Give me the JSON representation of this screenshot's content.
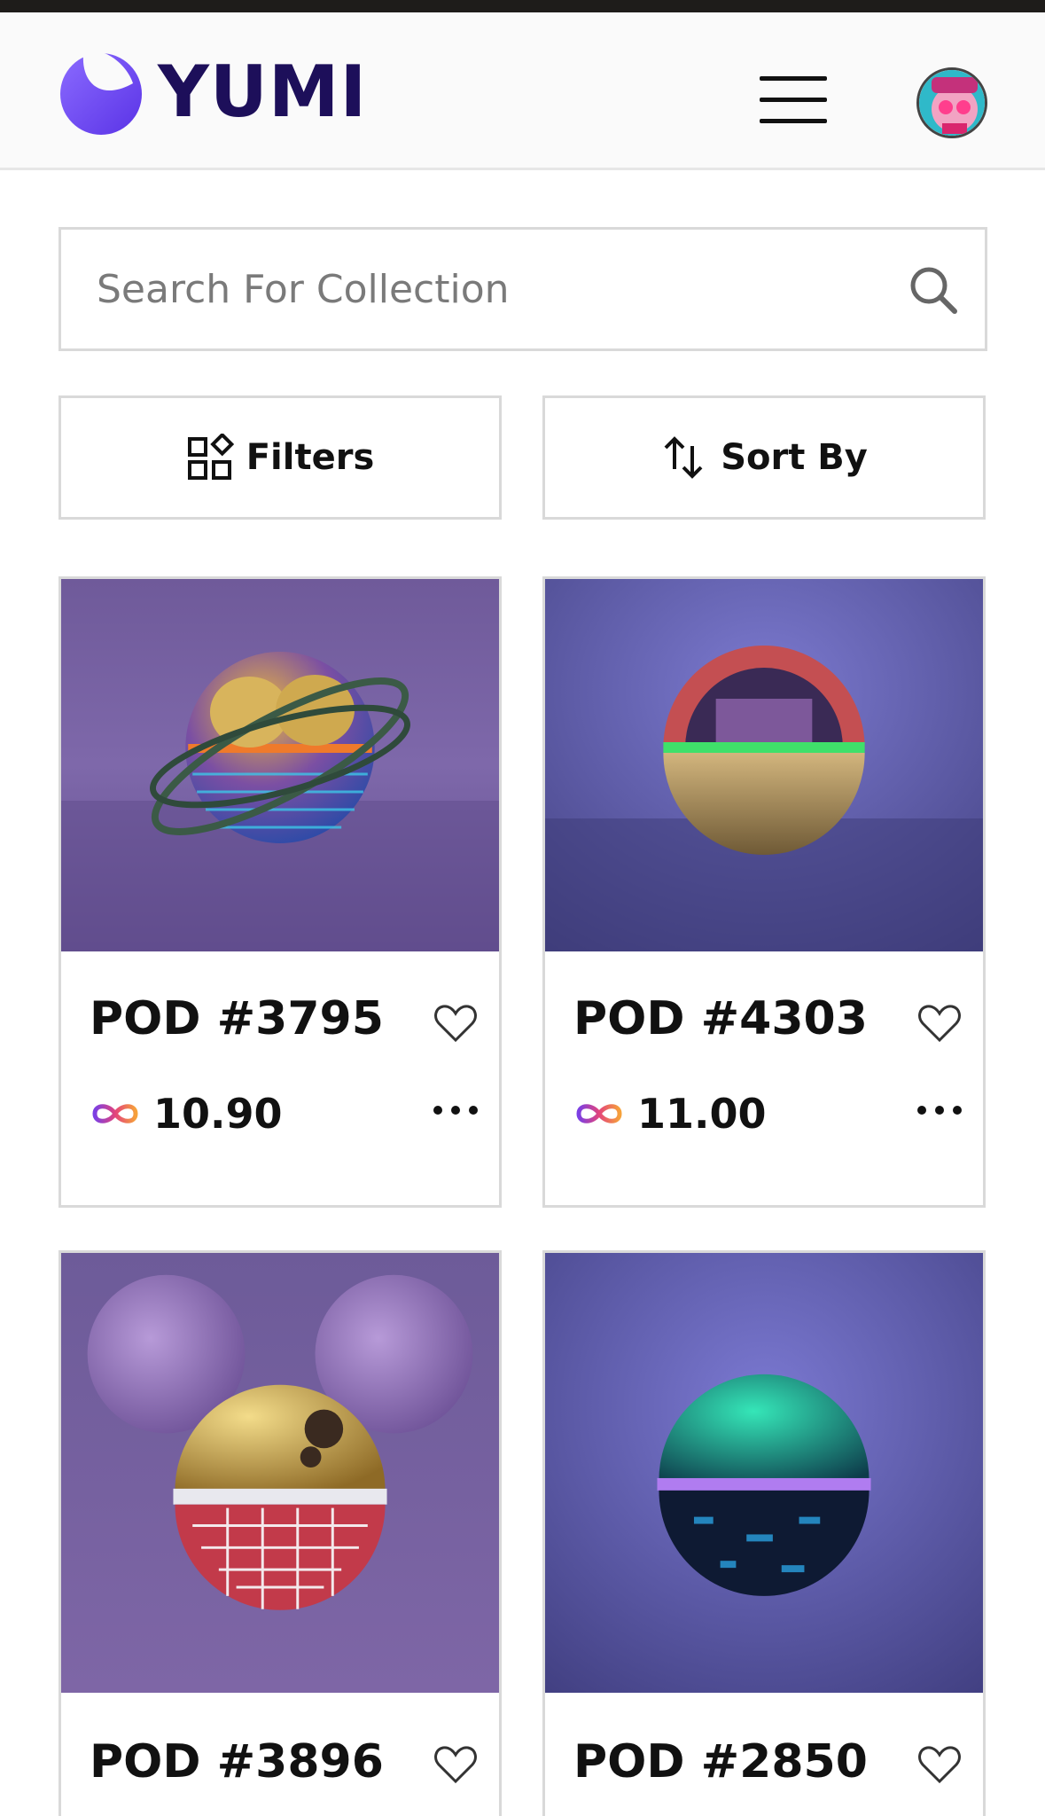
{
  "header": {
    "logo_text": "YUMI",
    "brand_color": "#6c4cf3",
    "logo_text_color": "#1d0f5a",
    "menu_icon": "hamburger-menu-icon",
    "avatar_icon": "user-avatar"
  },
  "search": {
    "placeholder": "Search For Collection",
    "value": "",
    "icon": "search-icon"
  },
  "toolbar": {
    "filters_label": "Filters",
    "filters_icon": "grid-filter-icon",
    "sort_label": "Sort By",
    "sort_icon": "sort-arrows-icon"
  },
  "items": [
    {
      "title": "POD #3795",
      "price": "10.90",
      "currency_icon": "icp-infinity-icon"
    },
    {
      "title": "POD #4303",
      "price": "11.00",
      "currency_icon": "icp-infinity-icon"
    },
    {
      "title": "POD #3896",
      "price": "",
      "currency_icon": "icp-infinity-icon"
    },
    {
      "title": "POD #2850",
      "price": "",
      "currency_icon": "icp-infinity-icon"
    }
  ]
}
